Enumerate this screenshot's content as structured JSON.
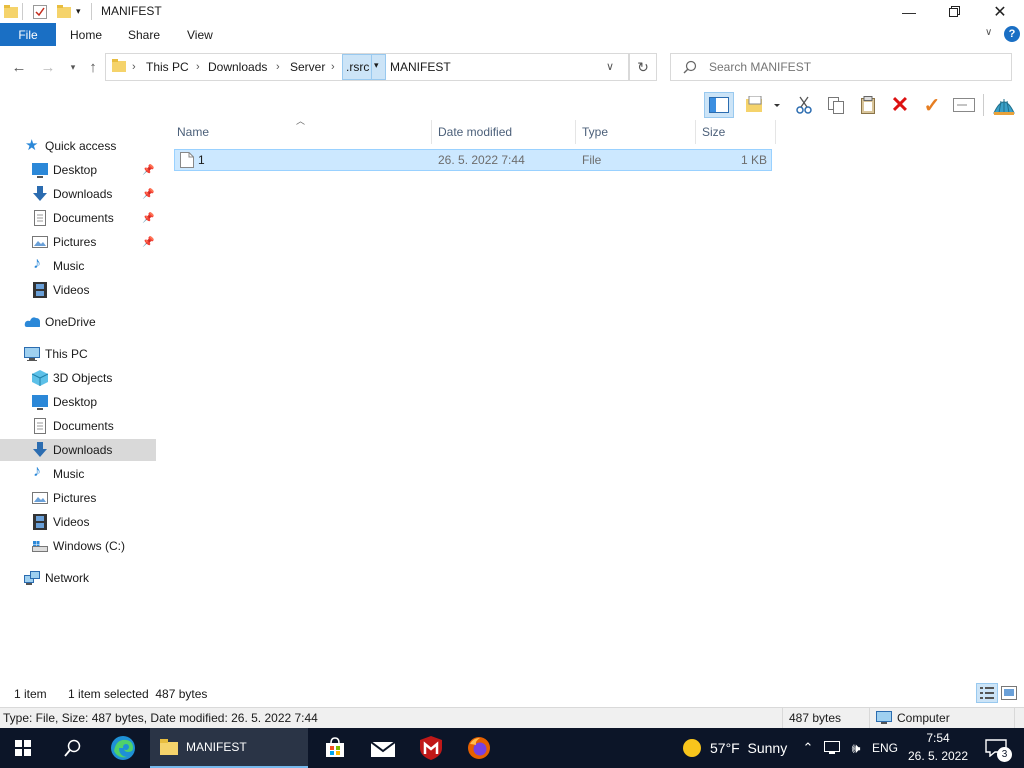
{
  "window": {
    "title": "MANIFEST"
  },
  "ribbon": {
    "tabs": [
      "File",
      "Home",
      "Share",
      "View"
    ]
  },
  "address": {
    "crumbs": [
      "This PC",
      "Downloads",
      "Server",
      ".rsrc",
      "MANIFEST"
    ]
  },
  "search": {
    "placeholder": "Search MANIFEST"
  },
  "nav": {
    "quick_access": "Quick access",
    "quick_items": [
      "Desktop",
      "Downloads",
      "Documents",
      "Pictures",
      "Music",
      "Videos"
    ],
    "onedrive": "OneDrive",
    "this_pc": "This PC",
    "pc_items": [
      "3D Objects",
      "Desktop",
      "Documents",
      "Downloads",
      "Music",
      "Pictures",
      "Videos",
      "Windows (C:)"
    ],
    "network": "Network"
  },
  "columns": [
    "Name",
    "Date modified",
    "Type",
    "Size"
  ],
  "files": [
    {
      "name": "1",
      "modified": "26. 5. 2022 7:44",
      "type": "File",
      "size": "1 KB"
    }
  ],
  "status": {
    "count": "1 item",
    "selected": "1 item selected  487 bytes"
  },
  "details": {
    "info": "Type: File, Size: 487 bytes, Date modified: 26. 5. 2022 7:44",
    "size": "487 bytes",
    "location": "Computer"
  },
  "taskbar": {
    "app_label": "MANIFEST",
    "weather": "57°F  Sunny",
    "lang": "ENG",
    "time": "7:54",
    "date": "26. 5. 2022",
    "notification_count": "3"
  },
  "colors": {
    "accent": "#1a6fc4",
    "selection": "#cce8ff",
    "taskbar": "#0c1528"
  }
}
